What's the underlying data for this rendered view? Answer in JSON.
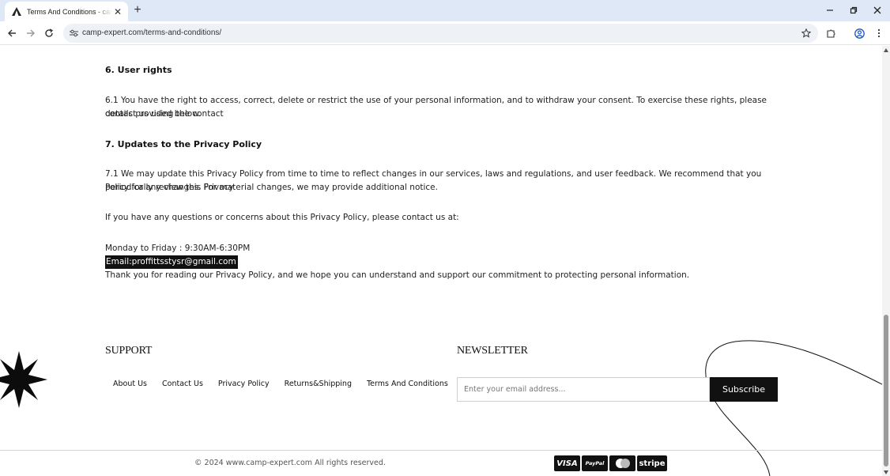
{
  "browser": {
    "tab_title": "Terms And Conditions - camp-expert",
    "url": "camp-expert.com/terms-and-conditions/",
    "new_tab_symbol": "+",
    "close_symbol": "✕"
  },
  "content": {
    "section6_heading": "6. User rights",
    "section6_p1_line1": "6.1 You have the right to access, correct, delete or restrict the use of your personal information, and to withdraw your consent. To exercise these rights, please contact us using the contact",
    "section6_p1_line2": "details provided below.",
    "section7_heading": "7. Updates to the Privacy Policy",
    "section7_p1_line1": "7.1 We may update this Privacy Policy from time to time to reflect changes in our services, laws and regulations, and user feedback. We recommend that you periodically review this Privacy",
    "section7_p1_line2": "Policy for any changes. For material changes, we may provide additional notice.",
    "contact_intro": "If you have any questions or concerns about this Privacy Policy, please contact us at:",
    "hours": "Monday to Friday : 9:30AM-6:30PM",
    "email": "Email:proffittsstysr@gmail.com",
    "closing": "Thank you for reading our Privacy Policy, and we hope you can understand and support our commitment to protecting personal information."
  },
  "footer": {
    "support_title": "SUPPORT",
    "links": [
      "About Us",
      "Contact Us",
      "Privacy Policy",
      "Returns&Shipping",
      "Terms And Conditions"
    ],
    "newsletter_title": "NEWSLETTER",
    "email_placeholder": "Enter your email address...",
    "subscribe_label": "Subscribe",
    "copyright": "© 2024 www.camp-expert.com All rights reserved.",
    "payments": [
      "VISA",
      "PayPal",
      "MasterCard",
      "stripe"
    ]
  },
  "icons": {
    "favicon": "tent-icon",
    "back": "back-arrow-icon",
    "forward": "forward-arrow-icon",
    "reload": "reload-icon",
    "site_info": "tune-icon",
    "bookmark": "star-icon",
    "extensions": "puzzle-icon",
    "profile": "profile-icon",
    "menu": "kebab-menu-icon"
  },
  "colors": {
    "tabbar_bg": "#dfe8f7",
    "accent_dark": "#111111",
    "subscribe_bg": "#111111"
  }
}
